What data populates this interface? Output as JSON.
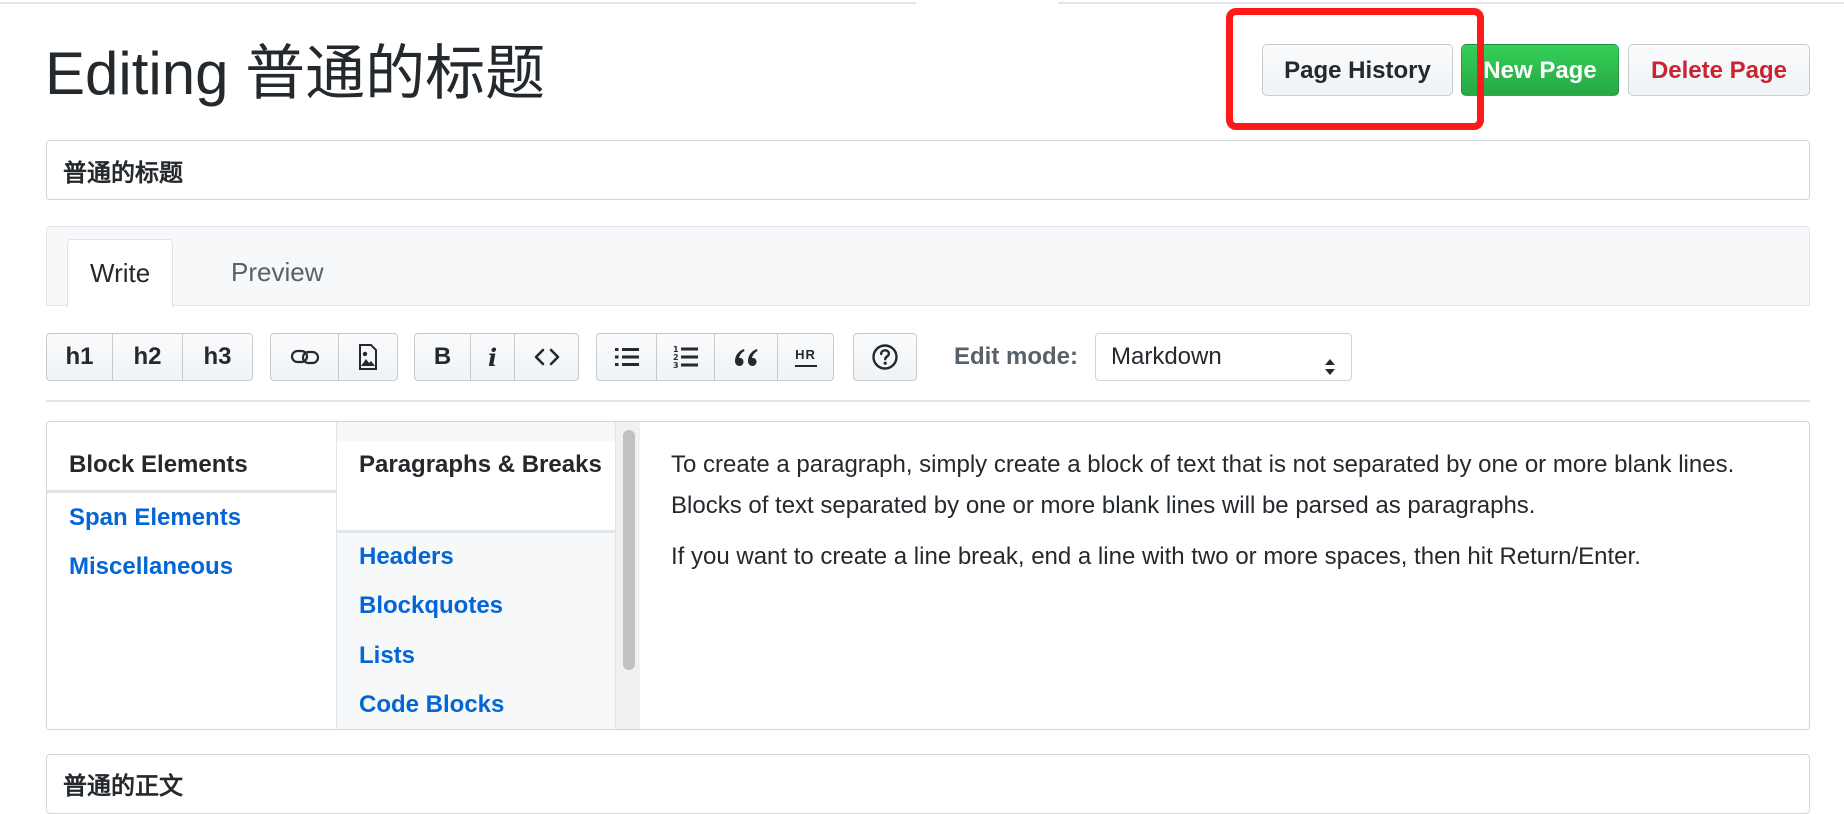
{
  "header": {
    "title": "Editing 普通的标题",
    "buttons": {
      "page_history": "Page History",
      "new_page": "New Page",
      "delete_page": "Delete Page"
    }
  },
  "title_input": {
    "value": "普通的标题"
  },
  "tabs": [
    {
      "label": "Write",
      "selected": true
    },
    {
      "label": "Preview",
      "selected": false
    }
  ],
  "toolbar": {
    "headers": [
      "h1",
      "h2",
      "h3"
    ],
    "icons": {
      "link": "link-icon",
      "image": "image-icon",
      "italic": "i",
      "code": "code-icon",
      "unordered_list": "unordered-list-icon",
      "ordered_list": "ordered-list-icon",
      "quote": "quote-icon",
      "hr": "HR",
      "help": "help-icon"
    },
    "bold": "B",
    "edit_mode_label": "Edit mode:",
    "edit_mode_value": "Markdown"
  },
  "help": {
    "categories": [
      "Block Elements",
      "Span Elements",
      "Miscellaneous"
    ],
    "topics": [
      "Paragraphs & Breaks",
      "Headers",
      "Blockquotes",
      "Lists",
      "Code Blocks"
    ],
    "paragraphs": [
      "To create a paragraph, simply create a block of text that is not separated by one or more blank lines. Blocks of text separated by one or more blank lines will be parsed as paragraphs.",
      "If you want to create a line break, end a line with two or more spaces, then hit Return/Enter."
    ]
  },
  "body_editor": {
    "value": "普通的正文"
  },
  "colors": {
    "primary_green": "#28a745",
    "danger_red": "#cb2431",
    "link_blue": "#0366d6",
    "highlight_red": "#ff1a1a"
  }
}
